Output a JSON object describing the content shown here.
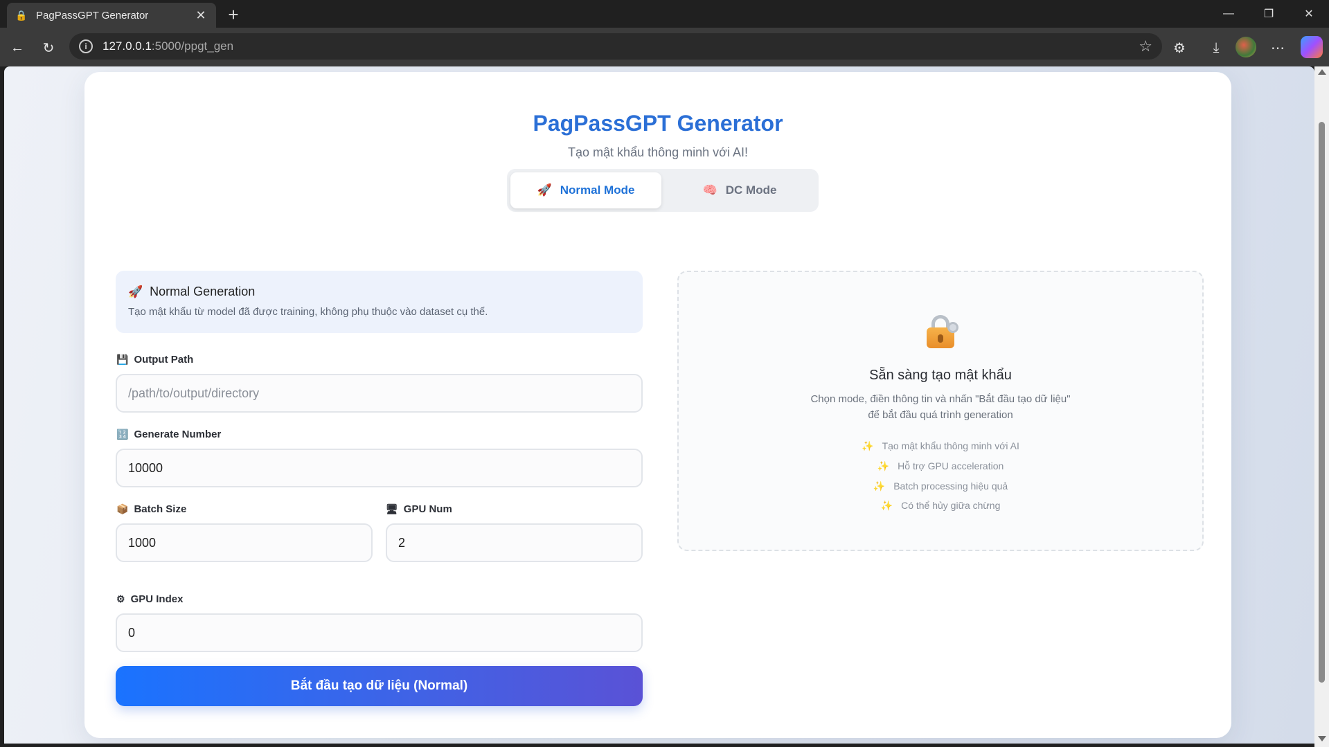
{
  "browser": {
    "tab_title": "PagPassGPT Generator",
    "url_host": "127.0.0.1",
    "url_path": ":5000/ppgt_gen"
  },
  "header": {
    "title": "PagPassGPT Generator",
    "subtitle": "Tạo mật khẩu thông minh với AI!"
  },
  "modes": {
    "normal_label": "Normal Mode",
    "dc_label": "DC Mode",
    "active": "normal"
  },
  "info_box": {
    "title": "Normal Generation",
    "description": "Tạo mật khẩu từ model đã được training, không phụ thuộc vào dataset cụ thể."
  },
  "form": {
    "output_path_label": "Output Path",
    "output_path_value": "",
    "output_path_placeholder": "/path/to/output/directory",
    "generate_number_label": "Generate Number",
    "generate_number_value": "10000",
    "batch_size_label": "Batch Size",
    "batch_size_value": "1000",
    "gpu_num_label": "GPU Num",
    "gpu_num_value": "2",
    "gpu_index_label": "GPU Index",
    "gpu_index_value": "0",
    "submit_label": "Bắt đầu tạo dữ liệu (Normal)"
  },
  "ready_panel": {
    "title": "Sẵn sàng tạo mật khẩu",
    "description_line1": "Chọn mode, điền thông tin và nhấn \"Bắt đầu tạo dữ liệu\"",
    "description_line2": "để bắt đầu quá trình generation",
    "features": [
      "Tạo mật khẩu thông minh với AI",
      "Hỗ trợ GPU acceleration",
      "Batch processing hiệu quả",
      "Có thể hủy giữa chừng"
    ]
  },
  "colors": {
    "accent": "#2b6fd6",
    "button_gradient_start": "#1a73ff",
    "button_gradient_end": "#5a52d6"
  },
  "icons": {
    "normal_mode": "rocket-icon",
    "dc_mode": "brain-icon",
    "output_path": "floppy-disk-icon",
    "generate_number": "numbers-icon",
    "batch_size": "package-icon",
    "gpu_num": "computer-icon",
    "gpu_index": "gear-icon",
    "ready": "lock-key-icon",
    "feature": "sparkles-icon"
  }
}
